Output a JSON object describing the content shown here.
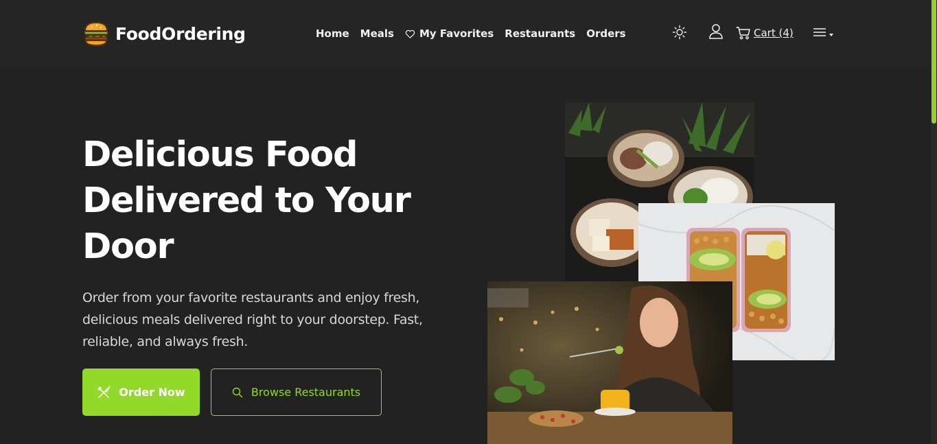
{
  "brand": {
    "name": "FoodOrdering",
    "logo_icon": "burger-icon"
  },
  "nav": {
    "items": [
      {
        "label": "Home"
      },
      {
        "label": "Meals"
      },
      {
        "label": "My Favorites",
        "icon": "heart-icon"
      },
      {
        "label": "Restaurants"
      },
      {
        "label": "Orders"
      }
    ]
  },
  "header_actions": {
    "theme_icon": "sun-icon",
    "user_icon": "user-icon",
    "cart_label": "Cart (4)",
    "cart_icon": "cart-icon",
    "menu_icon": "hamburger-menu-icon"
  },
  "hero": {
    "title": "Delicious Food Delivered to Your Door",
    "subtitle": "Order from your favorite restaurants and enjoy fresh, delicious meals delivered right to your doorstep. Fast, reliable, and always fresh.",
    "primary_button": {
      "label": "Order Now",
      "icon": "utensils-icon"
    },
    "secondary_button": {
      "label": "Browse Restaurants",
      "icon": "search-icon"
    }
  },
  "colors": {
    "background": "#222222",
    "header": "#252525",
    "accent": "#92d92a",
    "text": "#ffffff",
    "muted_text": "#d8d8d8"
  }
}
